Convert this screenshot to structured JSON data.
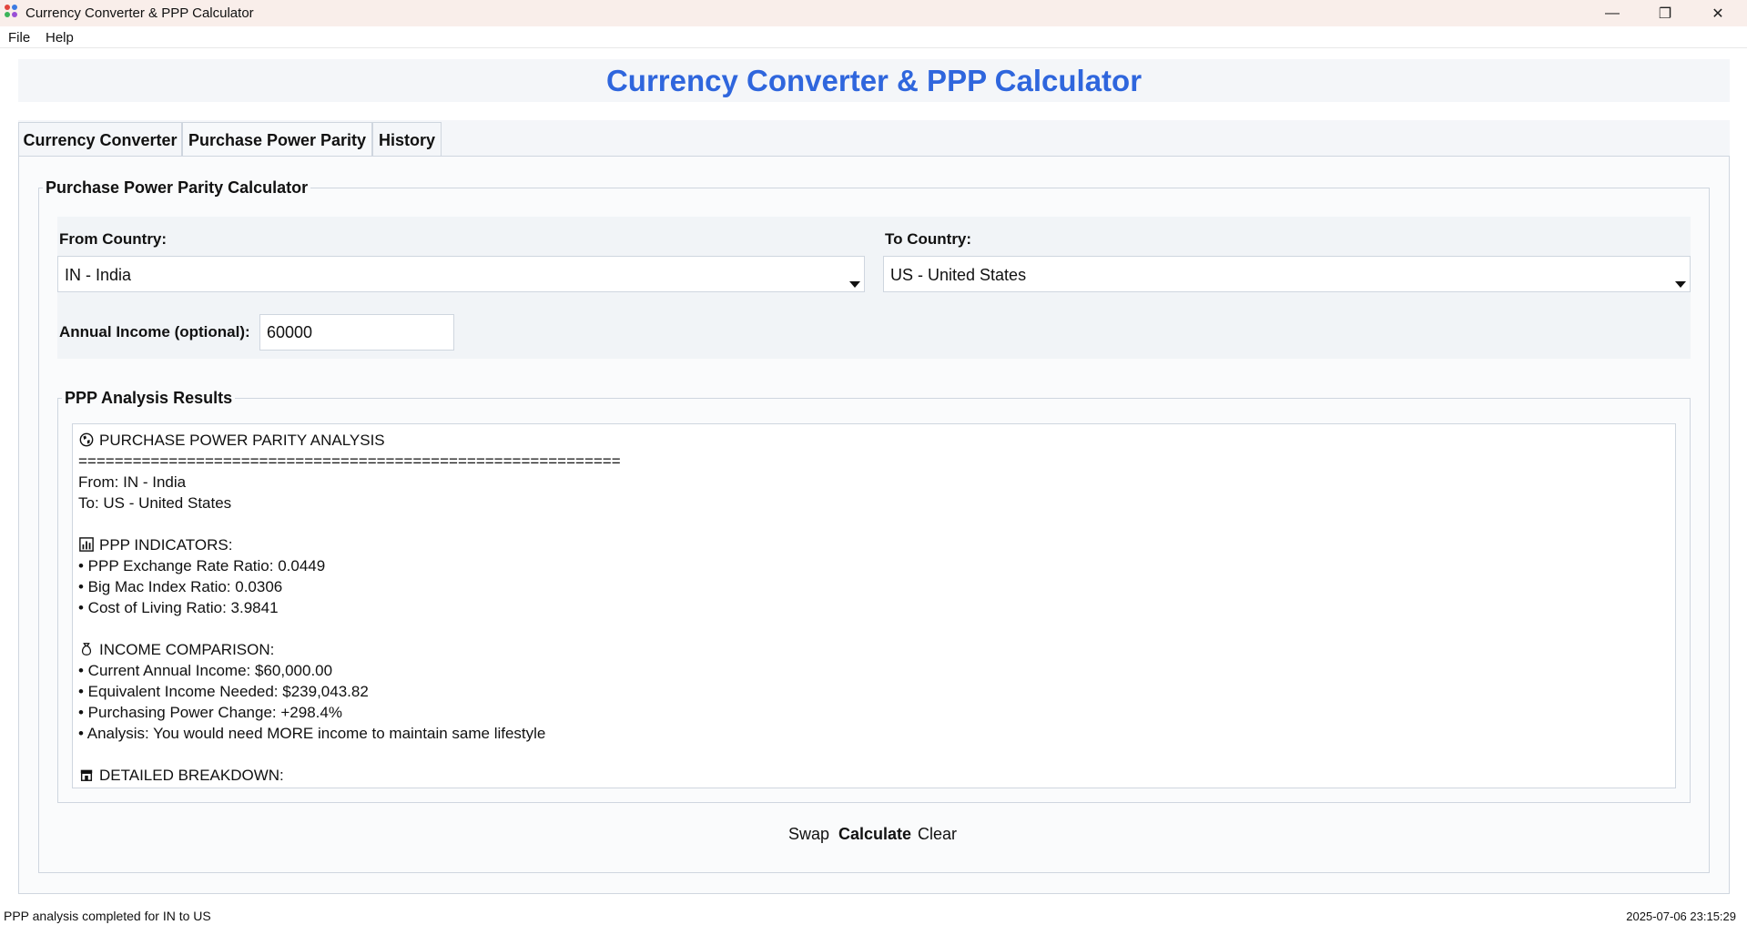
{
  "window": {
    "title": "Currency Converter & PPP Calculator",
    "minimize_glyph": "—",
    "restore_glyph": "❐",
    "close_glyph": "✕"
  },
  "menu": {
    "items": [
      {
        "label": "File"
      },
      {
        "label": "Help"
      }
    ]
  },
  "header": {
    "title": "Currency Converter & PPP Calculator"
  },
  "tabs": [
    {
      "label": "Currency Converter",
      "active": false
    },
    {
      "label": "Purchase Power Parity",
      "active": true
    },
    {
      "label": "History",
      "active": false
    }
  ],
  "ppp": {
    "group_title": "Purchase Power Parity Calculator",
    "from_label": "From Country:",
    "from_value": "IN - India",
    "to_label": "To Country:",
    "to_value": "US - United States",
    "income_label": "Annual Income (optional):",
    "income_value": "60000",
    "results_title": "PPP Analysis Results",
    "results": {
      "heading": "PURCHASE POWER PARITY ANALYSIS",
      "separator": "============================================================",
      "from_line": "From: IN - India",
      "to_line": "To: US - United States",
      "indicators_heading": "PPP INDICATORS:",
      "indicators": [
        "• PPP Exchange Rate Ratio: 0.0449",
        "• Big Mac Index Ratio: 0.0306",
        "• Cost of Living Ratio: 3.9841"
      ],
      "income_heading": "INCOME COMPARISON:",
      "income_lines": [
        "• Current Annual Income: $60,000.00",
        "• Equivalent Income Needed: $239,043.82",
        "• Purchasing Power Change: +298.4%",
        "• Analysis: You would need MORE income to maintain same lifestyle"
      ],
      "breakdown_heading": "DETAILED BREAKDOWN:"
    },
    "buttons": {
      "swap": "Swap",
      "calculate": "Calculate",
      "clear": "Clear"
    }
  },
  "status": {
    "message": "PPP analysis completed for IN to US",
    "timestamp": "2025-07-06 23:15:29"
  },
  "colors": {
    "title_blue": "#2f66dd",
    "titlebar_bg": "#f9eeea",
    "panel_bg": "#fafbfc"
  }
}
